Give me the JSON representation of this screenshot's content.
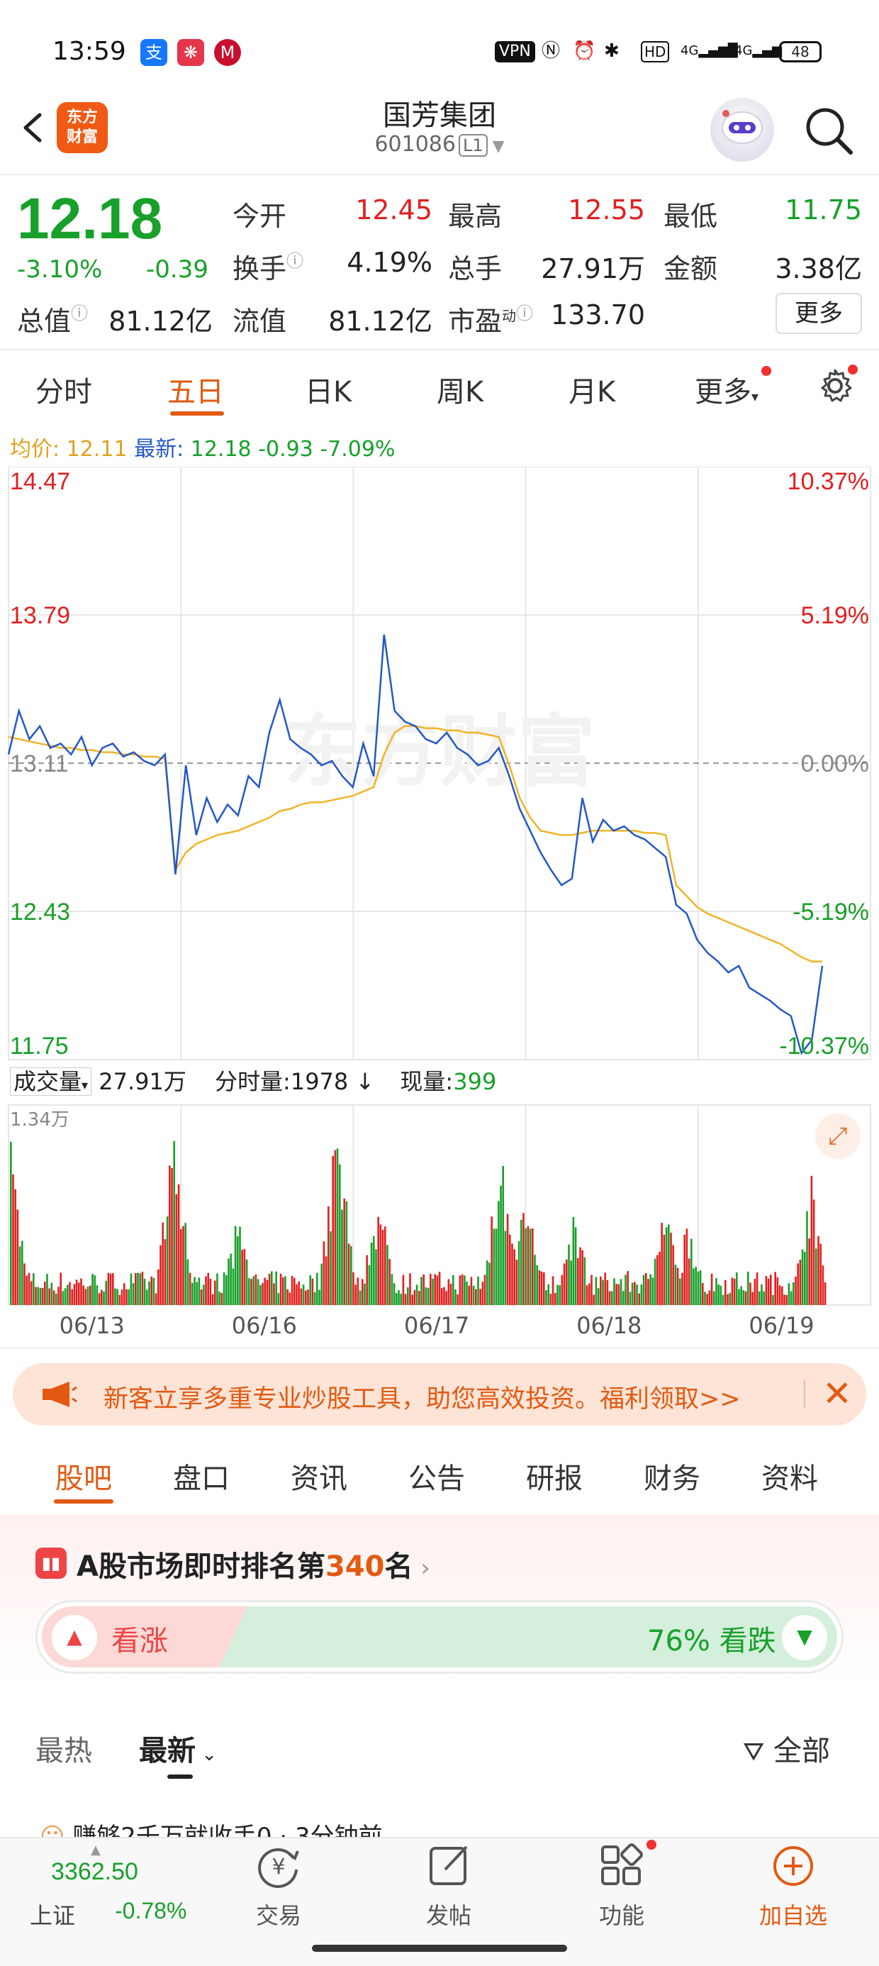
{
  "status_bar": {
    "time": "13:59",
    "vpn": "VPN",
    "battery": "48",
    "hd": "HD",
    "net1": "4G",
    "net2": "4G",
    "app_icons": [
      "alipay-icon",
      "cloud-icon",
      "bank-icon"
    ]
  },
  "header": {
    "logo_line1": "东方",
    "logo_line2": "财富",
    "title": "国芳集团",
    "code": "601086",
    "level": "L1"
  },
  "quote": {
    "price": "12.18",
    "change_pct": "-3.10%",
    "change": "-0.39",
    "open_label": "今开",
    "open": "12.45",
    "high_label": "最高",
    "high": "12.55",
    "low_label": "最低",
    "low": "11.75",
    "turnover_label": "换手",
    "turnover": "4.19%",
    "volume_label": "总手",
    "volume": "27.91万",
    "amount_label": "金额",
    "amount": "3.38亿",
    "mktcap_label": "总值",
    "mktcap": "81.12亿",
    "float_label": "流值",
    "float": "81.12亿",
    "pe_label": "市盈",
    "pe_sup": "动",
    "pe": "133.70",
    "more": "更多"
  },
  "period_tabs": [
    "分时",
    "五日",
    "日K",
    "周K",
    "月K",
    "更多"
  ],
  "avg_line": {
    "avg_label": "均价:",
    "avg": "12.11",
    "latest_label": "最新:",
    "latest": "12.18",
    "diff": "-0.93",
    "diff_pct": "-7.09%"
  },
  "volume_bar": {
    "label": "成交量",
    "total": "27.91万",
    "tick_label": "分时量:",
    "tick": "1978",
    "now_label": "现量:",
    "now": "399",
    "max": "1.34万"
  },
  "chart_data": {
    "type": "line",
    "title": "",
    "y_labels_left": [
      "14.47",
      "13.79",
      "13.11",
      "12.43",
      "11.75"
    ],
    "y_labels_right": [
      "10.37%",
      "5.19%",
      "0.00%",
      "-5.19%",
      "-10.37%"
    ],
    "ylim": [
      11.75,
      14.47
    ],
    "prev_close": 13.11,
    "x_labels": [
      "06/13",
      "06/16",
      "06/17",
      "06/18",
      "06/19"
    ],
    "series": [
      {
        "name": "",
        "color": "#2458c8",
        "values": [
          13.15,
          13.35,
          13.22,
          13.28,
          13.18,
          13.2,
          13.15,
          13.23,
          13.1,
          13.18,
          13.2,
          13.14,
          13.16,
          13.12,
          13.1,
          13.15,
          12.6,
          13.1,
          12.78,
          12.95,
          12.84,
          12.92,
          12.87,
          13.05,
          13.0,
          13.25,
          13.4,
          13.22,
          13.18,
          13.15,
          13.1,
          13.12,
          13.05,
          13.0,
          13.2,
          13.05,
          13.7,
          13.35,
          13.3,
          13.28,
          13.22,
          13.2,
          13.25,
          13.18,
          13.15,
          13.1,
          13.12,
          13.18,
          13.05,
          12.9,
          12.8,
          12.7,
          12.62,
          12.55,
          12.58,
          12.95,
          12.75,
          12.85,
          12.8,
          12.82,
          12.78,
          12.76,
          12.72,
          12.68,
          12.46,
          12.42,
          12.3,
          12.24,
          12.2,
          12.15,
          12.18,
          12.08,
          12.05,
          12.02,
          11.98,
          11.95,
          11.78,
          11.84,
          12.18
        ]
      },
      {
        "name": "",
        "color": "#f0b428",
        "values": [
          13.23,
          13.22,
          13.21,
          13.2,
          13.19,
          13.18,
          13.18,
          13.17,
          13.17,
          13.16,
          13.16,
          13.15,
          13.15,
          13.14,
          13.14,
          13.13,
          12.62,
          12.7,
          12.74,
          12.76,
          12.78,
          12.79,
          12.8,
          12.82,
          12.84,
          12.86,
          12.89,
          12.9,
          12.92,
          12.93,
          12.93,
          12.94,
          12.95,
          12.96,
          12.98,
          13.0,
          13.15,
          13.25,
          13.28,
          13.28,
          13.27,
          13.27,
          13.26,
          13.26,
          13.25,
          13.25,
          13.24,
          13.23,
          13.1,
          12.95,
          12.86,
          12.8,
          12.79,
          12.78,
          12.78,
          12.79,
          12.8,
          12.8,
          12.8,
          12.8,
          12.8,
          12.79,
          12.79,
          12.78,
          12.55,
          12.5,
          12.45,
          12.42,
          12.4,
          12.38,
          12.36,
          12.34,
          12.32,
          12.3,
          12.28,
          12.25,
          12.22,
          12.2,
          12.2
        ]
      }
    ],
    "grid": true,
    "volume": {
      "type": "bar",
      "ylim": [
        0,
        13400
      ]
    }
  },
  "banner": {
    "text": "新客立享多重专业炒股工具，助您高效投资。福利领取>>"
  },
  "section_tabs": [
    "股吧",
    "盘口",
    "资讯",
    "公告",
    "研报",
    "财务",
    "资料"
  ],
  "ranking": {
    "prefix": "A股市场即时排名第",
    "rank": "340",
    "suffix": "名",
    "up_label": "看涨",
    "down_label": "76% 看跌",
    "down_pct": 0.76
  },
  "sort_tabs": {
    "hot": "最热",
    "latest": "最新",
    "filter": "全部"
  },
  "post_peek": "赚够2千万就收手0 · 3分钟前",
  "bottom_nav": {
    "index_value": "3362.50",
    "index_name": "上证",
    "index_change": "-0.78%",
    "items": [
      "交易",
      "发帖",
      "功能",
      "加自选"
    ]
  }
}
